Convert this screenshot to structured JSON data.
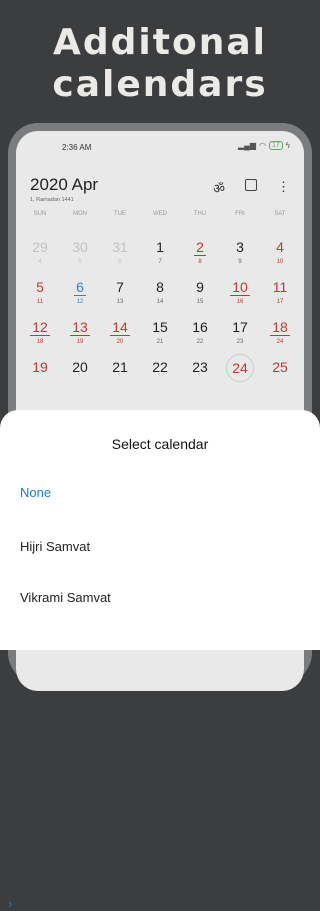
{
  "promo": {
    "line1": "Additonal",
    "line2": "calendars"
  },
  "status": {
    "time": "2:36 AM",
    "battery": "17"
  },
  "header": {
    "month_title": "2020 Apr",
    "sub": "1, Ramadan 1441",
    "om_icon": "ॐ",
    "menu_icon": "⋮"
  },
  "weekdays": [
    "SUN",
    "MON",
    "TUE",
    "WED",
    "THU",
    "FRI",
    "SAT"
  ],
  "days": [
    {
      "n": "29",
      "s": "4",
      "cls": "muted"
    },
    {
      "n": "30",
      "s": "5",
      "cls": "muted"
    },
    {
      "n": "31",
      "s": "6",
      "cls": "muted"
    },
    {
      "n": "1",
      "s": "7",
      "cls": ""
    },
    {
      "n": "2",
      "s": "8",
      "cls": "red ul"
    },
    {
      "n": "3",
      "s": "9",
      "cls": ""
    },
    {
      "n": "4",
      "s": "10",
      "cls": "red"
    },
    {
      "n": "5",
      "s": "11",
      "cls": "red"
    },
    {
      "n": "6",
      "s": "12",
      "cls": "today"
    },
    {
      "n": "7",
      "s": "13",
      "cls": ""
    },
    {
      "n": "8",
      "s": "14",
      "cls": ""
    },
    {
      "n": "9",
      "s": "15",
      "cls": ""
    },
    {
      "n": "10",
      "s": "16",
      "cls": "red ul"
    },
    {
      "n": "11",
      "s": "17",
      "cls": "red"
    },
    {
      "n": "12",
      "s": "18",
      "cls": "red ul"
    },
    {
      "n": "13",
      "s": "19",
      "cls": "red ul"
    },
    {
      "n": "14",
      "s": "20",
      "cls": "red ul"
    },
    {
      "n": "15",
      "s": "21",
      "cls": ""
    },
    {
      "n": "16",
      "s": "22",
      "cls": ""
    },
    {
      "n": "17",
      "s": "23",
      "cls": ""
    },
    {
      "n": "18",
      "s": "24",
      "cls": "red ul"
    },
    {
      "n": "19",
      "s": "",
      "cls": "red"
    },
    {
      "n": "20",
      "s": "",
      "cls": ""
    },
    {
      "n": "21",
      "s": "",
      "cls": ""
    },
    {
      "n": "22",
      "s": "",
      "cls": ""
    },
    {
      "n": "23",
      "s": "",
      "cls": ""
    },
    {
      "n": "24",
      "s": "",
      "cls": "red sel"
    },
    {
      "n": "25",
      "s": "",
      "cls": "red"
    }
  ],
  "sheet": {
    "title": "Select calendar",
    "selected_marker": "›",
    "options": [
      {
        "label": "None",
        "selected": true
      },
      {
        "label": "Hijri Samvat",
        "selected": false
      },
      {
        "label": "Vikrami Samvat",
        "selected": false
      }
    ]
  }
}
